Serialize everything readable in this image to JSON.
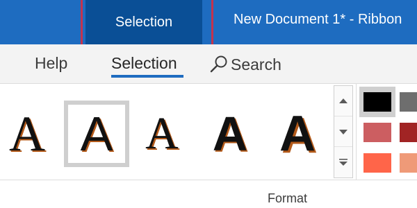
{
  "titlebar": {
    "context_tab": "Selection",
    "doc_title": "New Document 1* - Ribbon",
    "bg_color": "#1e6cc0",
    "context_bg_color": "#0a4f96",
    "highlight_outline_color": "#c4334e"
  },
  "tabs": [
    {
      "label": "Help"
    },
    {
      "label": "Selection",
      "active": true
    },
    {
      "label": "Search",
      "icon": "search-icon"
    }
  ],
  "gallery": {
    "styles": [
      {
        "glyph": "A"
      },
      {
        "glyph": "A",
        "selected": true
      },
      {
        "glyph": "A"
      },
      {
        "glyph": "A"
      },
      {
        "glyph": "A"
      }
    ],
    "scroll_icons": [
      "scroll-up-icon",
      "scroll-down-icon",
      "gallery-more-icon"
    ]
  },
  "swatches": [
    "#000000",
    "#6e6e6e",
    "#cc5e61",
    "#a12424",
    "#ff6549",
    "#ef9a78"
  ],
  "group": {
    "label": "Format"
  }
}
